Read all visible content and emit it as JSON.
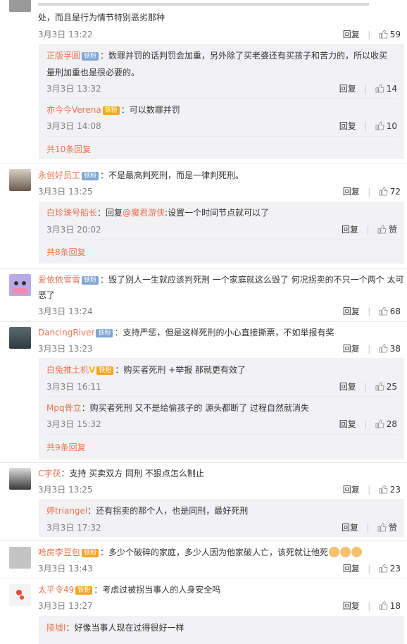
{
  "c0": {
    "text_line1": "",
    "text_line2": "处，而且是行为情节特别恶劣那种",
    "time": "3月3日 13:22",
    "reply": "回复",
    "likes": "59"
  },
  "c0_sub": [
    {
      "user": "正版孚圆",
      "badge": "铁粉",
      "text": "：数罪并罚的话判罚会加重，另外除了买老婆还有买孩子和苦力的，所以收买",
      "text2": "量刑加重也是很必要的。",
      "time": "3月3日 13:32",
      "reply": "回复",
      "likes": "14"
    },
    {
      "user": "亦今今Verena",
      "badge": "铁粉",
      "text": "：可以数罪并罚",
      "time": "3月3日 14:08",
      "reply": "回复",
      "likes": "10"
    }
  ],
  "c0_more": "共10条回复",
  "c1": {
    "user": "永创好员工",
    "badge": "铁粉",
    "text": "：不是最高判死刑，而是一律判死刑。",
    "time": "3月3日 13:25",
    "reply": "回复",
    "likes": "72"
  },
  "c1_sub": [
    {
      "user": "白珍珠号船长",
      "text_a": "：回复",
      "mention": "@魔君游侠",
      "text_b": ":设置一个时间节点就可以了",
      "time": "3月3日 20:02",
      "reply": "回复",
      "likes": "赞"
    }
  ],
  "c1_more": "共8条回复",
  "c2": {
    "user": "爱依依雪雪",
    "badge": "铁粉",
    "text": "：毁了别人一生就应该判死刑 一个家庭就这么毁了 何况拐卖的不只一个两个 太可",
    "text2": "恶了",
    "time": "3月3日 13:24",
    "reply": "回复",
    "likes": "68"
  },
  "c3": {
    "user": "DancingRiver",
    "badge": "铁粉",
    "text": "：支持严惩，但是这样死刑的小心直接撕票，不如举报有奖",
    "time": "3月3日 13:23",
    "reply": "回复",
    "likes": "38"
  },
  "c3_sub": [
    {
      "user": "白兔推土机",
      "vmark": "V",
      "badge": "铁粉",
      "text": "：购买者死刑 +举报 那就更有效了",
      "time": "3月3日 16:11",
      "reply": "回复",
      "likes": "25"
    },
    {
      "user": "Mpq骨立",
      "text": "：购买者死刑 又不是给偷孩子的 源头都断了 过程自然就消失",
      "time": "3月3日 15:32",
      "reply": "回复",
      "likes": "28"
    }
  ],
  "c3_more": "共9条回复",
  "c4": {
    "user": "C字茯",
    "text": "：支持 买卖双方 同刑 不狠点怎么制止",
    "time": "3月3日 13:25",
    "reply": "回复",
    "likes": "23"
  },
  "c4_sub": [
    {
      "user": "婷triangel",
      "text": "：还有拐卖的那个人，也是同刑，最好死刑",
      "time": "3月3日 17:32",
      "reply": "回复",
      "likes": "赞"
    }
  ],
  "c5": {
    "user": "哈房李豆包",
    "badge": "铁粉",
    "text": "：多少个破碎的家庭，多少人因为他家破人亡，该死就让他死",
    "time": "3月3日 13:43",
    "reply": "回复",
    "likes": "23"
  },
  "c6": {
    "user": "太平令49",
    "badge": "铁粉",
    "text": "：考虑过被拐当事人的人身安全吗",
    "time": "3月3日 13:27",
    "reply": "回复",
    "likes": "18"
  },
  "c6_sub": [
    {
      "user": "陵墟I",
      "text": "：好像当事人现在过得很好一样"
    }
  ]
}
